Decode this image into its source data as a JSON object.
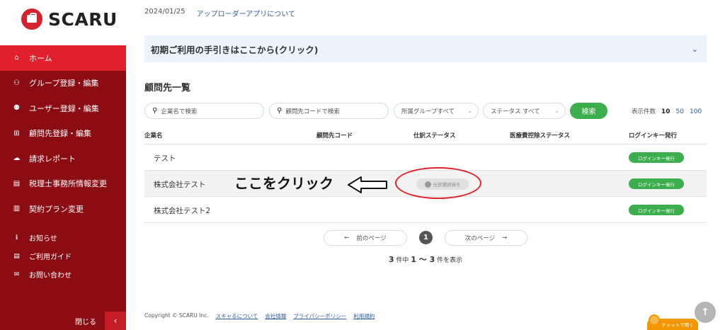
{
  "brand": {
    "name": "SCARU"
  },
  "sidebar": {
    "items": [
      {
        "label": "ホーム",
        "icon": "home-icon",
        "glyph": "⌂"
      },
      {
        "label": "グループ登録・編集",
        "icon": "group-icon",
        "glyph": "⚇"
      },
      {
        "label": "ユーザー登録・編集",
        "icon": "add-user-icon",
        "glyph": "⚉"
      },
      {
        "label": "顧問先登録・編集",
        "icon": "plus-square-icon",
        "glyph": "⊞"
      },
      {
        "label": "請求レポート",
        "icon": "cloud-icon",
        "glyph": "☁"
      },
      {
        "label": "税理士事務所情報変更",
        "icon": "document-icon",
        "glyph": "▤"
      },
      {
        "label": "契約プラン変更",
        "icon": "book-icon",
        "glyph": "▥"
      }
    ],
    "sub_items": [
      {
        "label": "お知らせ",
        "icon": "info-icon",
        "glyph": "ℹ"
      },
      {
        "label": "ご利用ガイド",
        "icon": "guide-icon",
        "glyph": "▤"
      },
      {
        "label": "お問い合わせ",
        "icon": "mail-icon",
        "glyph": "✉"
      }
    ],
    "close_label": "閉じる",
    "close_glyph": "‹"
  },
  "notice": {
    "date": "2024/01/25",
    "link": "アップローダーアプリについて"
  },
  "guide": {
    "title": "初期ご利用の手引きはここから(クリック)",
    "chevron": "⌄"
  },
  "section_title": "顧問先一覧",
  "filters": {
    "company_placeholder": "企業名で検索",
    "code_placeholder": "顧問先コードで検索",
    "group_select": "所属グループすべて",
    "status_select": "ステータス すべて",
    "search_button": "検索",
    "per_page_label": "表示件数",
    "per_page_options": [
      "10",
      "50",
      "100"
    ]
  },
  "table": {
    "headers": [
      "企業名",
      "顧問先コード",
      "仕訳ステータス",
      "医療費控除ステータス",
      "ログインキー発行"
    ],
    "rows": [
      {
        "name": "テスト",
        "code": "",
        "status": "",
        "medical": "",
        "action": "ログインキー発行"
      },
      {
        "name": "株式会社テスト",
        "code": "",
        "status": "仕訳選択待ち",
        "medical": "",
        "action": "ログインキー発行"
      },
      {
        "name": "株式会社テスト2",
        "code": "",
        "status": "",
        "medical": "",
        "action": "ログインキー発行"
      }
    ]
  },
  "annotation": {
    "text": "ここをクリック"
  },
  "pagination": {
    "prev": "前のページ",
    "next": "次のページ",
    "current": "1",
    "total": "3",
    "total_suffix": "件中",
    "range": "1 〜 3",
    "range_suffix": "件を表示"
  },
  "footer": {
    "copyright": "Copyright © SCARU Inc.",
    "links": [
      "スキャるについて",
      "会社情報",
      "プライバシーポリシー",
      "利用規約"
    ]
  },
  "chat": {
    "label": "チャットで聞く"
  },
  "colors": {
    "brand_red": "#e0202c",
    "sidebar_dark": "#8c0c14",
    "green": "#3cae4d",
    "link_blue": "#2c5aa0"
  }
}
